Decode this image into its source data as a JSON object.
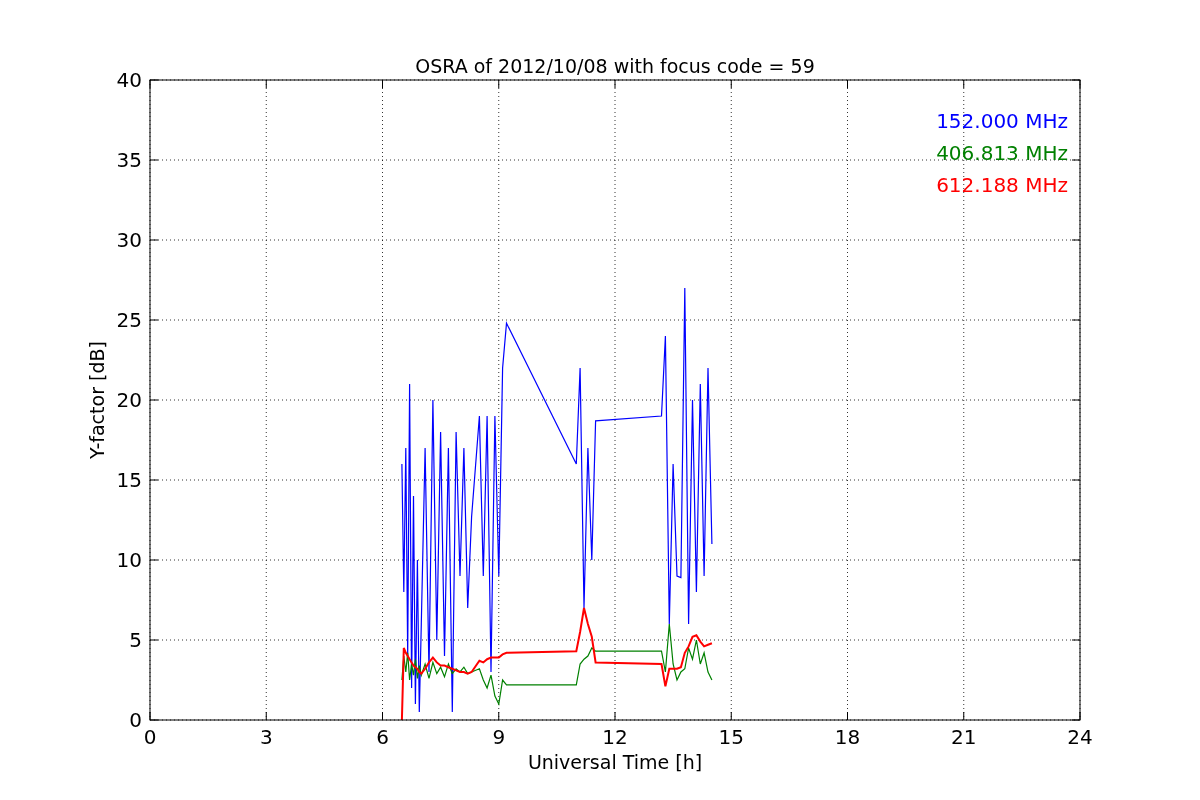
{
  "figure": {
    "chart_data": {
      "type": "line",
      "title": "OSRA of 2012/10/08 with focus code = 59",
      "xlabel": "Universal Time [h]",
      "ylabel": "Y-factor [dB]",
      "x": [
        6.5,
        6.55,
        6.6,
        6.65,
        6.7,
        6.75,
        6.8,
        6.85,
        6.9,
        6.95,
        7.0,
        7.1,
        7.2,
        7.3,
        7.4,
        7.5,
        7.6,
        7.7,
        7.8,
        7.9,
        8.0,
        8.1,
        8.2,
        8.3,
        8.5,
        8.6,
        8.7,
        8.8,
        8.9,
        9.0,
        9.1,
        9.2,
        11.0,
        11.1,
        11.2,
        11.3,
        11.4,
        11.5,
        13.2,
        13.3,
        13.4,
        13.5,
        13.6,
        13.7,
        13.8,
        13.9,
        14.0,
        14.1,
        14.2,
        14.3,
        14.4,
        14.5
      ],
      "series": [
        {
          "name": "152.000 MHz",
          "color": "#0000ff",
          "values": [
            16,
            8,
            17,
            4,
            21,
            2,
            14,
            1,
            10,
            0.5,
            6,
            17,
            3,
            20,
            5,
            18,
            4,
            17,
            0.5,
            18,
            9,
            17,
            7,
            12.7,
            19,
            9,
            19,
            3,
            19,
            9,
            22,
            24.8,
            16,
            22,
            7,
            17,
            10,
            18.7,
            19,
            24,
            6,
            16,
            9,
            8.9,
            27,
            6,
            20,
            8,
            21,
            9,
            22,
            11
          ]
        },
        {
          "name": "406.813 MHz",
          "color": "#008000",
          "values": [
            2.5,
            4,
            3,
            4.2,
            2.5,
            3.5,
            2.8,
            3.8,
            2.6,
            3.4,
            2.8,
            3.5,
            2.6,
            3.6,
            2.9,
            3.3,
            2.7,
            3.5,
            2.9,
            3.2,
            3.0,
            3.3,
            2.9,
            3.0,
            3.2,
            2.5,
            2.0,
            2.8,
            1.5,
            1.0,
            2.5,
            2.2,
            2.2,
            3.5,
            3.8,
            4.0,
            4.5,
            4.3,
            4.3,
            3.0,
            6.0,
            3.5,
            2.5,
            3.0,
            3.2,
            4.5,
            3.8,
            5.0,
            3.5,
            4.2,
            3.0,
            2.5
          ]
        },
        {
          "name": "612.188 MHz",
          "color": "#ff0000",
          "values": [
            0,
            4.5,
            4.2,
            4.0,
            3.8,
            3.6,
            3.4,
            3.3,
            3.2,
            3.0,
            2.9,
            3.2,
            3.6,
            3.9,
            3.6,
            3.4,
            3.4,
            3.3,
            3.2,
            3.1,
            3.0,
            3.0,
            2.9,
            3.0,
            3.7,
            3.6,
            3.8,
            3.9,
            3.9,
            3.9,
            4.1,
            4.2,
            4.3,
            5.5,
            7.0,
            6.0,
            5.2,
            3.6,
            3.5,
            2.1,
            3.2,
            3.2,
            3.2,
            3.3,
            4.2,
            4.6,
            5.2,
            5.3,
            4.9,
            4.6,
            4.7,
            4.8
          ]
        }
      ],
      "grid": true,
      "xlim": [
        0,
        24
      ],
      "ylim": [
        0,
        40
      ],
      "xticks": [
        0,
        3,
        6,
        9,
        12,
        15,
        18,
        21,
        24
      ],
      "yticks": [
        0,
        5,
        10,
        15,
        20,
        25,
        30,
        35,
        40
      ]
    }
  }
}
